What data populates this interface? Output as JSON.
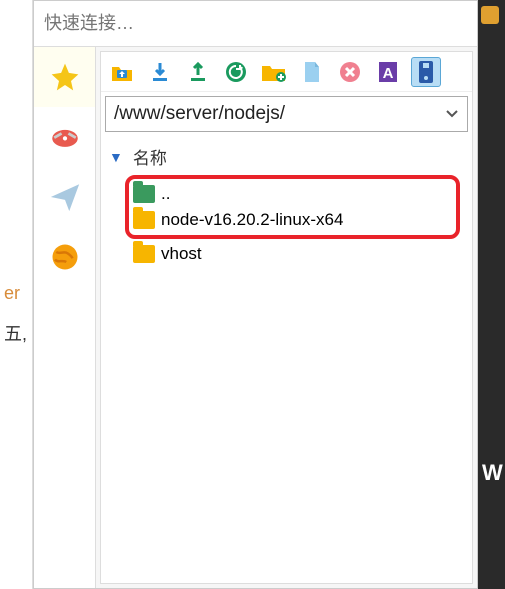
{
  "quick_connect": {
    "placeholder": "快速连接…"
  },
  "left_margin": {
    "line1": "er",
    "line2": "五,"
  },
  "right_dark": {
    "letter": "W"
  },
  "sidebar": {
    "tabs": [
      {
        "name": "favorites",
        "icon": "star"
      },
      {
        "name": "tools",
        "icon": "swiss-knife"
      },
      {
        "name": "send",
        "icon": "paper-plane"
      },
      {
        "name": "network",
        "icon": "globe"
      }
    ]
  },
  "toolbar": {
    "buttons": [
      {
        "name": "up-folder",
        "icon": "folder-up"
      },
      {
        "name": "download",
        "icon": "download"
      },
      {
        "name": "upload",
        "icon": "upload"
      },
      {
        "name": "refresh",
        "icon": "refresh"
      },
      {
        "name": "new-folder",
        "icon": "folder-plus"
      },
      {
        "name": "new-file",
        "icon": "file"
      },
      {
        "name": "delete",
        "icon": "close"
      },
      {
        "name": "rename",
        "icon": "text-a"
      },
      {
        "name": "properties",
        "icon": "disk",
        "selected": true
      }
    ]
  },
  "path": {
    "value": "/www/server/nodejs/"
  },
  "columns": {
    "name": "名称"
  },
  "files": {
    "parent": {
      "label": ".."
    },
    "items": [
      {
        "name": "node-v16.20.2-linux-x64",
        "highlighted": true
      },
      {
        "name": "vhost",
        "highlighted": false
      }
    ]
  }
}
